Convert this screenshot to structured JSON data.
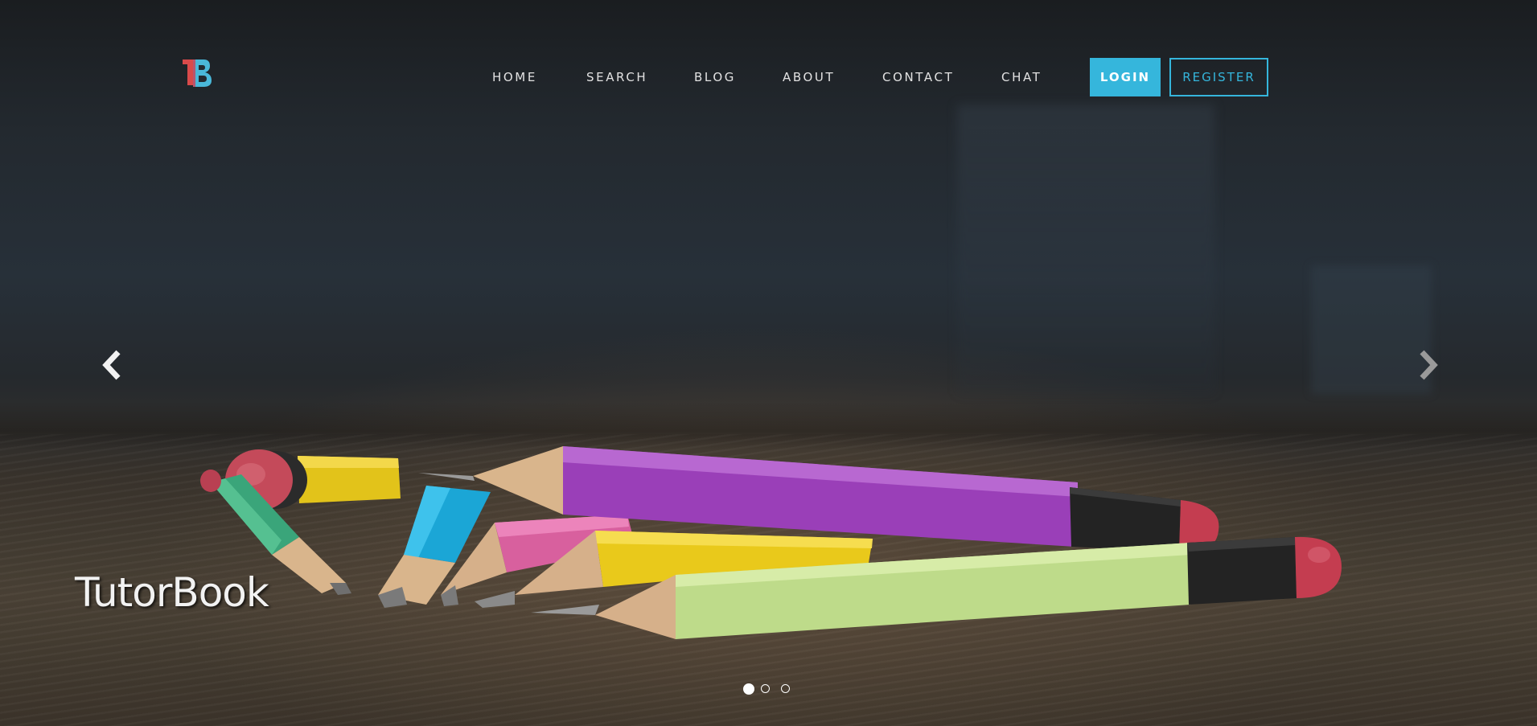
{
  "header": {
    "logo_icon": "tb-logo-icon",
    "nav": [
      {
        "label": "HOME"
      },
      {
        "label": "SEARCH"
      },
      {
        "label": "BLOG"
      },
      {
        "label": "ABOUT"
      },
      {
        "label": "CONTACT"
      },
      {
        "label": "CHAT"
      }
    ],
    "login_label": "LOGIN",
    "register_label": "REGISTER"
  },
  "carousel": {
    "title": "TutorBook",
    "prev_icon": "chevron-left-icon",
    "next_icon": "chevron-right-icon",
    "slide_count": 3,
    "active_slide": 1,
    "background_image": "colored-pencils-photo"
  },
  "colors": {
    "accent": "#35b6dc",
    "logo_red": "#d94a4a",
    "logo_blue": "#4ab8d9"
  }
}
